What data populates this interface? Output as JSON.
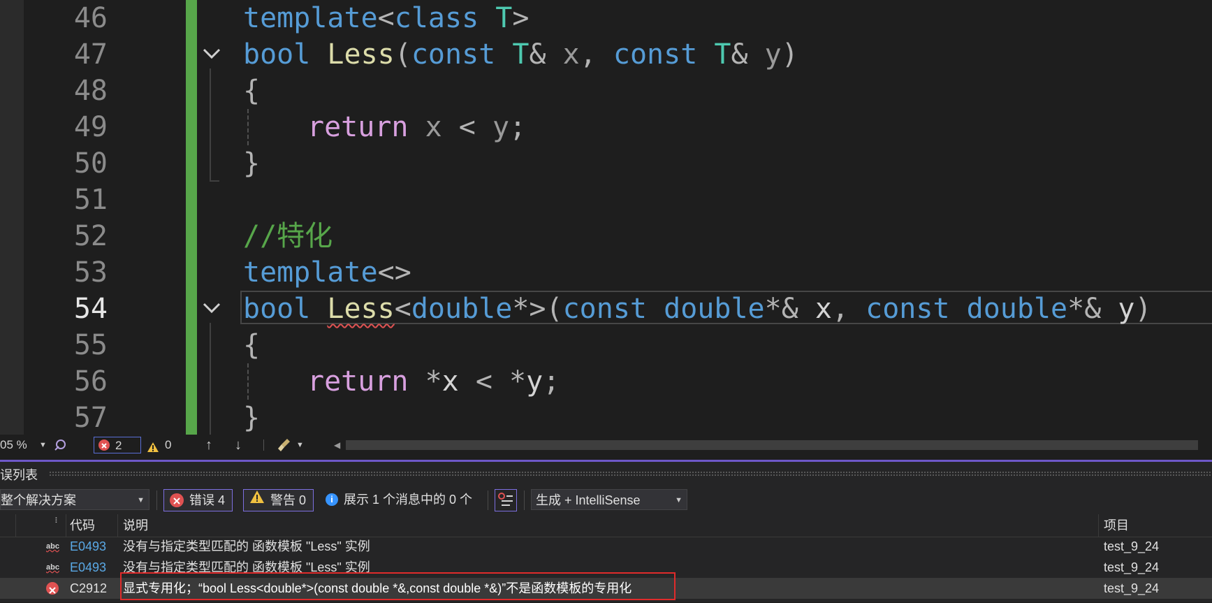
{
  "editor": {
    "line_numbers": [
      "46",
      "47",
      "48",
      "49",
      "50",
      "51",
      "52",
      "53",
      "54",
      "55",
      "56",
      "57"
    ],
    "current_line": "54",
    "lines": {
      "l46": {
        "kw1": "template",
        "p1": "<",
        "kw2": "class",
        "p2": " ",
        "ty": "T",
        "p3": ">"
      },
      "l47": {
        "kw1": "bool",
        "fn": "Less",
        "p1": "(",
        "kw2": "const",
        "ty1": "T",
        "p2": "& ",
        "v1": "x",
        "p3": ", ",
        "kw3": "const",
        "ty2": "T",
        "p4": "& ",
        "v2": "y",
        "p5": ")"
      },
      "l48": {
        "p": "{"
      },
      "l49": {
        "ct": "return",
        "p1": " ",
        "v1": "x",
        "p2": " < ",
        "v2": "y",
        "p3": ";"
      },
      "l50": {
        "p": "}"
      },
      "l52": {
        "cm": "//特化"
      },
      "l53": {
        "kw": "template",
        "p": "<>"
      },
      "l54": {
        "kw1": "bool",
        "fn": "Less",
        "p1": "<",
        "kw2": "double",
        "p2": "*>(",
        "kw3": "const",
        "kw4": "double",
        "p3": "*& ",
        "v1": "x",
        "p4": ", ",
        "kw5": "const",
        "kw6": "double",
        "p5": "*& ",
        "v2": "y",
        "p6": ")"
      },
      "l55": {
        "p": "{"
      },
      "l56": {
        "ct": "return",
        "p1": " *",
        "v1": "x",
        "p2": " < *",
        "v2": "y",
        "p3": ";"
      },
      "l57": {
        "p": "}"
      }
    }
  },
  "statusbar": {
    "zoom": "05 %",
    "error_count": "2",
    "warning_count": "0"
  },
  "error_list": {
    "title": "错误列表",
    "scope": "整个解决方案",
    "errors_button": "错误 4",
    "warnings_button": "警告 0",
    "messages_text": "展示 1 个消息中的 0 个",
    "build_filter": "生成 + IntelliSense",
    "columns": {
      "code": "代码",
      "description": "说明",
      "project": "项目"
    },
    "rows": [
      {
        "icon": "abc",
        "code": "E0493",
        "description": "没有与指定类型匹配的 函数模板 \"Less\" 实例",
        "project": "test_9_24"
      },
      {
        "icon": "abc",
        "code": "E0493",
        "description": "没有与指定类型匹配的 函数模板 \"Less\" 实例",
        "project": "test_9_24"
      },
      {
        "icon": "error",
        "code": "C2912",
        "description": "显式专用化；“bool Less<double*>(const double *&,const double *&)”不是函数模板的专用化",
        "project": "test_9_24"
      }
    ]
  },
  "colors": {
    "accent": "#6e58c8",
    "change_bar": "#57a64a",
    "error_red": "#e02b2b",
    "link_blue": "#5aa9e6"
  }
}
